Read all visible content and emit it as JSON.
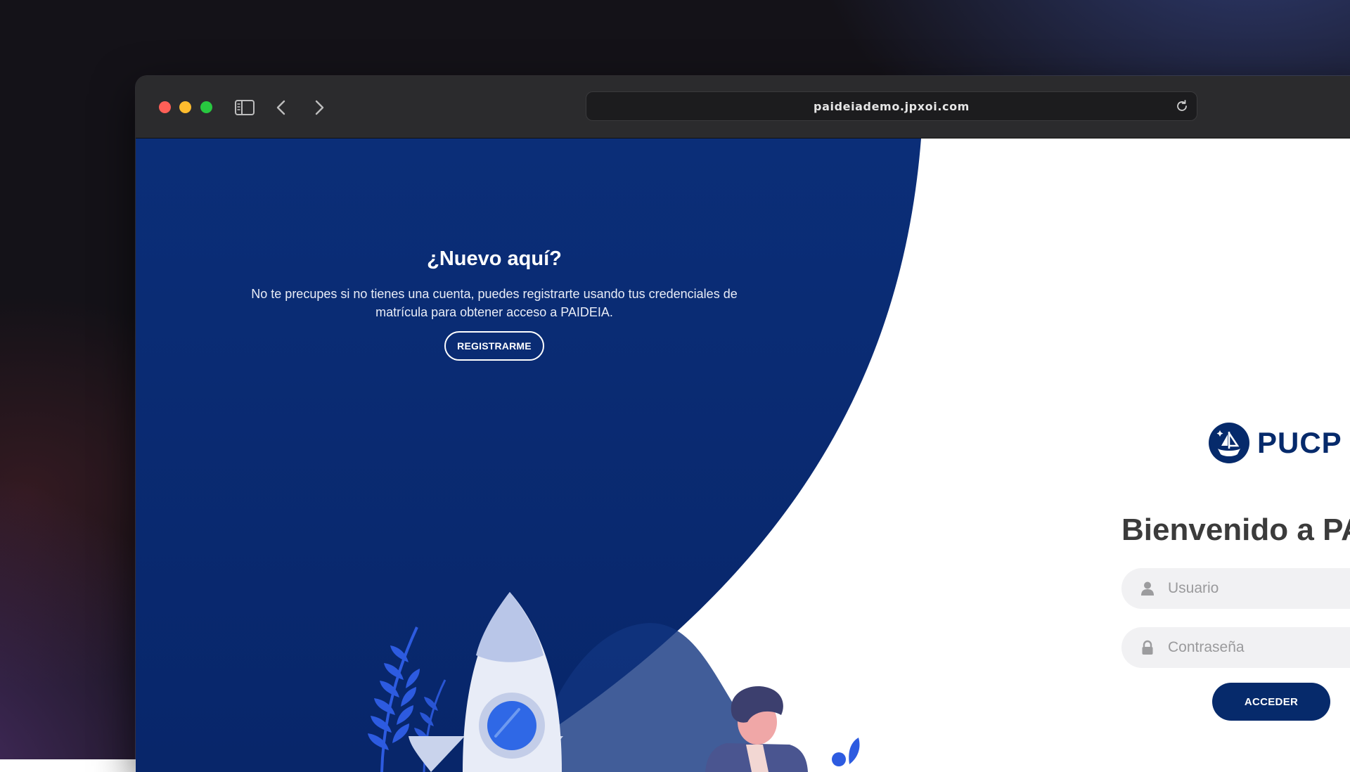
{
  "browser": {
    "url": "paideiademo.jpxoi.com"
  },
  "signup": {
    "title": "¿Nuevo aquí?",
    "text": "No te precupes si no tienes una cuenta, puedes registrarte usando tus credenciales de matrícula para obtener acceso a PAIDEIA.",
    "button_label": "REGISTRARME"
  },
  "login": {
    "logo_text": "PUCP",
    "welcome": "Bienvenido a PA",
    "username_placeholder": "Usuario",
    "password_placeholder": "Contraseña",
    "button_label": "ACCEDER"
  },
  "colors": {
    "brand_blue": "#062a6b",
    "panel_blue": "#0a2a70",
    "traffic_red": "#ff5f57",
    "traffic_yellow": "#febc2e",
    "traffic_green": "#28c840"
  },
  "icons": [
    "sidebar-icon",
    "back-arrow-icon",
    "forward-arrow-icon",
    "reload-icon",
    "user-icon",
    "lock-icon",
    "pucp-seal-icon"
  ]
}
